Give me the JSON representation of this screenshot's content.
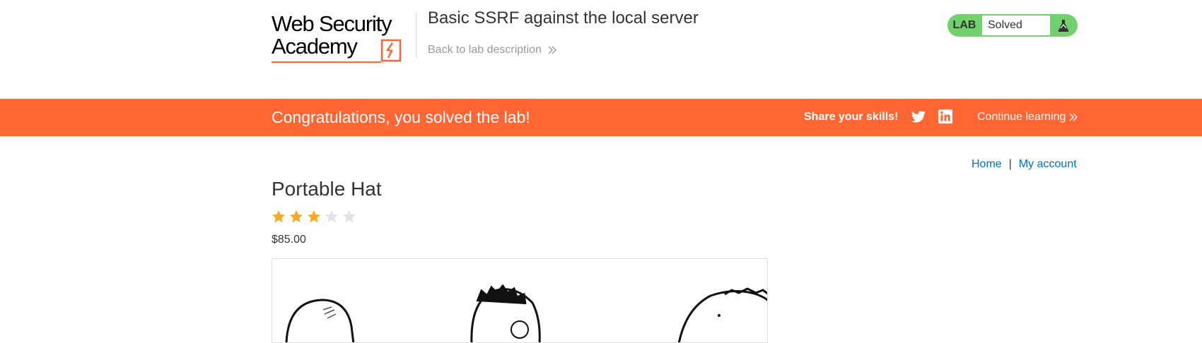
{
  "header": {
    "logo_line1": "Web Security",
    "logo_line2": "Academy",
    "lab_title": "Basic SSRF against the local server",
    "back_link": "Back to lab description"
  },
  "lab_status": {
    "badge": "LAB",
    "state": "Solved",
    "color": "#70d16d"
  },
  "banner": {
    "message": "Congratulations, you solved the lab!",
    "share_label": "Share your skills!",
    "continue_label": "Continue learning",
    "color": "#ff6633",
    "icons": [
      "twitter-icon",
      "linkedin-icon"
    ]
  },
  "nav": {
    "home": "Home",
    "separator": "|",
    "account": "My account"
  },
  "product": {
    "title": "Portable Hat",
    "rating": 3,
    "rating_max": 5,
    "price": "$85.00"
  }
}
